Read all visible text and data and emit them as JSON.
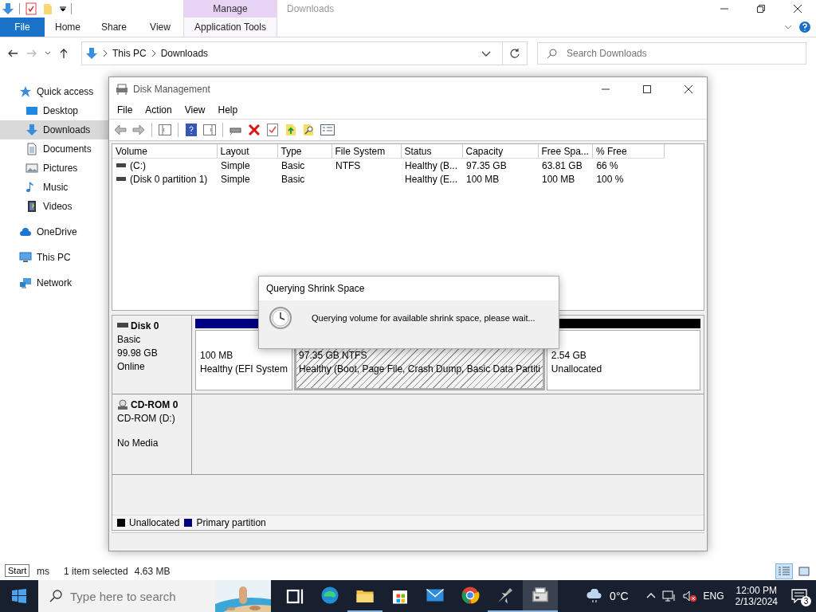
{
  "explorer": {
    "title": "Downloads",
    "context_header": "Manage",
    "tabs": [
      {
        "label": "File",
        "kind": "file"
      },
      {
        "label": "Home",
        "kind": "tab"
      },
      {
        "label": "Share",
        "kind": "tab"
      },
      {
        "label": "View",
        "kind": "tab"
      },
      {
        "label": "Application Tools",
        "kind": "contextual"
      }
    ],
    "path": [
      "This PC",
      "Downloads"
    ],
    "search_placeholder": "Search Downloads",
    "sidebar": [
      {
        "label": "Quick access",
        "kind": "star",
        "selected": false,
        "children": [
          {
            "label": "Desktop",
            "kind": "desktop",
            "selected": false
          },
          {
            "label": "Downloads",
            "kind": "download",
            "selected": true
          },
          {
            "label": "Documents",
            "kind": "document",
            "selected": false
          },
          {
            "label": "Pictures",
            "kind": "pictures",
            "selected": false
          },
          {
            "label": "Music",
            "kind": "music",
            "selected": false
          },
          {
            "label": "Videos",
            "kind": "film",
            "selected": false
          }
        ]
      },
      {
        "label": "OneDrive",
        "kind": "cloud",
        "selected": false
      },
      {
        "label": "This PC",
        "kind": "monitor",
        "selected": false
      },
      {
        "label": "Network",
        "kind": "network",
        "selected": false
      }
    ],
    "status_bar": {
      "items": "ms",
      "selection": "1 item selected",
      "size": "4.63 MB"
    }
  },
  "disk_management": {
    "title": "Disk Management",
    "menu": [
      "File",
      "Action",
      "View",
      "Help"
    ],
    "columns": [
      "Volume",
      "Layout",
      "Type",
      "File System",
      "Status",
      "Capacity",
      "Free Spa...",
      "% Free"
    ],
    "rows": [
      [
        "(C:)",
        "Simple",
        "Basic",
        "NTFS",
        "Healthy (B...",
        "97.35 GB",
        "63.81 GB",
        "66 %"
      ],
      [
        "(Disk 0 partition 1)",
        "Simple",
        "Basic",
        "",
        "Healthy (E...",
        "100 MB",
        "100 MB",
        "100 %"
      ]
    ],
    "disks": [
      {
        "name": "Disk 0",
        "kind": "disk",
        "lines": [
          "Basic",
          "99.98 GB",
          "Online"
        ],
        "partitions": [
          {
            "size": "100 MB",
            "status": "Healthy (EFI System",
            "color": "#000080",
            "selected": false
          },
          {
            "size": "97.35 GB NTFS",
            "status": "Healthy (Boot, Page File, Crash Dump, Basic Data Partiti",
            "selected": true
          },
          {
            "size": "2.54 GB",
            "status": "Unallocated",
            "color": "#000000",
            "selected": false
          }
        ]
      },
      {
        "name": "CD-ROM 0",
        "kind": "cdrom",
        "lines": [
          "CD-ROM (D:)",
          "No Media"
        ]
      }
    ],
    "legend": [
      {
        "label": "Unallocated",
        "color": "#000000"
      },
      {
        "label": "Primary partition",
        "color": "#000080"
      }
    ]
  },
  "dialog": {
    "title": "Querying Shrink Space",
    "message": "Querying volume for available shrink space, please wait..."
  },
  "tooltip": "Start",
  "taskbar": {
    "search_placeholder": "Type here to search",
    "apps": [
      {
        "kind": "task-view",
        "running": false,
        "selected": false
      },
      {
        "kind": "edge",
        "running": false,
        "selected": false
      },
      {
        "kind": "folder",
        "running": true,
        "selected": false
      },
      {
        "kind": "store",
        "running": false,
        "selected": false
      },
      {
        "kind": "mail",
        "running": false,
        "selected": false
      },
      {
        "kind": "chrome",
        "running": false,
        "selected": false
      },
      {
        "kind": "plane",
        "running": true,
        "selected": false
      },
      {
        "kind": "disk",
        "running": true,
        "selected": true
      }
    ],
    "weather": "0°C",
    "language": "ENG",
    "time": "12:00 PM",
    "date": "2/13/2024",
    "notifications": "3"
  }
}
